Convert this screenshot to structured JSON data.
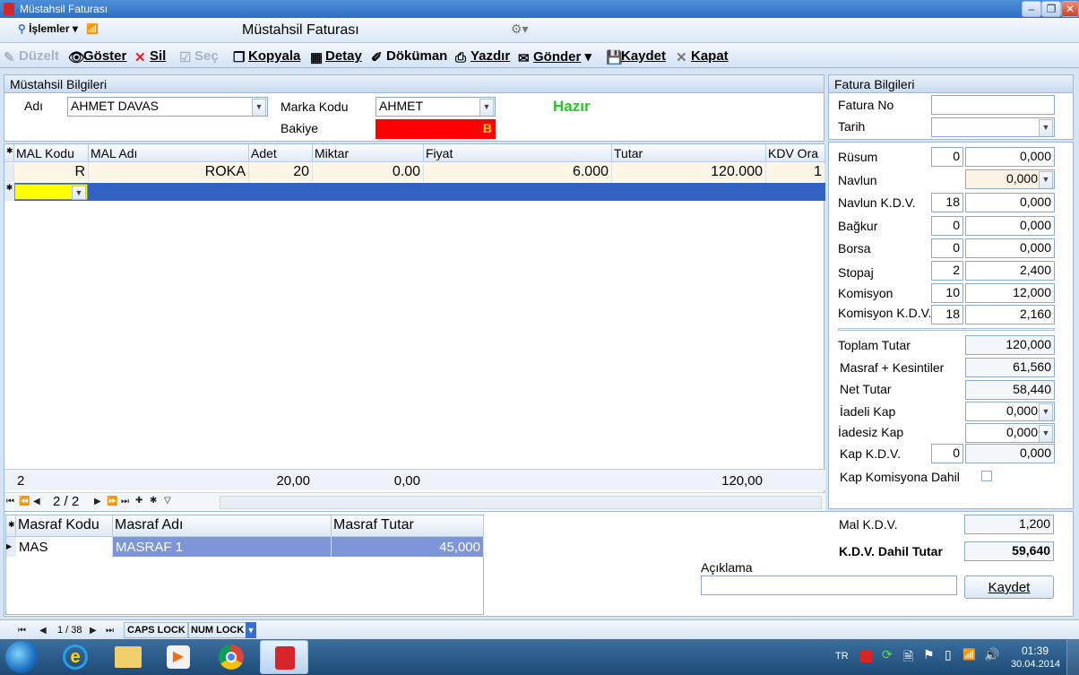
{
  "window": {
    "title": "Müstahsil Faturası"
  },
  "menubar": {
    "menu_label": "İşlemler",
    "form_title": "Müstahsil Faturası"
  },
  "toolbar": {
    "edit": "Düzelt",
    "show": "Göster",
    "delete": "Sil",
    "select": "Seç",
    "copy": "Kopyala",
    "detail": "Detay",
    "document": "Döküman",
    "print": "Yazdır",
    "send": "Gönder",
    "save": "Kaydet",
    "close": "Kapat"
  },
  "producer": {
    "header": "Müstahsil Bilgileri",
    "name_label": "Adı",
    "name_value": "AHMET DAVAS",
    "brand_label": "Marka Kodu",
    "brand_value": "AHMET",
    "balance_label": "Bakiye",
    "balance_value": "B",
    "status": "Hazır"
  },
  "items_grid": {
    "columns": [
      "MAL Kodu",
      "MAL Adı",
      "Adet",
      "Miktar",
      "Fiyat",
      "Tutar",
      "KDV Ora"
    ],
    "rows": [
      {
        "code": "R",
        "name": "ROKA",
        "qty": "20",
        "amount": "0.00",
        "price": "6.000",
        "total": "120.000",
        "vat": "1"
      }
    ],
    "footer": {
      "count": "2",
      "qty": "20,00",
      "amount": "0,00",
      "total": "120,00"
    },
    "nav": {
      "position": "2 / 2"
    }
  },
  "expense_grid": {
    "columns": [
      "Masraf Kodu",
      "Masraf Adı",
      "Masraf Tutar"
    ],
    "rows": [
      {
        "code": "MAS",
        "name": "MASRAF 1",
        "amount": "45,000"
      }
    ]
  },
  "invoice": {
    "header": "Fatura Bilgileri",
    "no_label": "Fatura No",
    "no_value": "",
    "date_label": "Tarih",
    "date_value": ""
  },
  "deductions": [
    {
      "label": "Rüsum",
      "rate": "0",
      "value": "0,000"
    },
    {
      "label": "Navlun",
      "rate": "",
      "value": "0,000"
    },
    {
      "label": "Navlun K.D.V.",
      "rate": "18",
      "value": "0,000"
    },
    {
      "label": "Bağkur",
      "rate": "0",
      "value": "0,000"
    },
    {
      "label": "Borsa",
      "rate": "0",
      "value": "0,000"
    },
    {
      "label": "Stopaj",
      "rate": "2",
      "value": "2,400"
    },
    {
      "label": "Komisyon",
      "rate": "10",
      "value": "12,000"
    },
    {
      "label": "Komisyon K.D.V.",
      "rate": "18",
      "value": "2,160"
    }
  ],
  "totals": {
    "total_label": "Toplam Tutar",
    "total_value": "120,000",
    "expenses_label": "Masraf + Kesintiler",
    "expenses_value": "61,560",
    "net_label": "Net Tutar",
    "net_value": "58,440",
    "returnable_label": "İadeli Kap",
    "returnable_value": "0,000",
    "nonreturnable_label": "İadesiz Kap",
    "nonreturnable_value": "0,000",
    "cont_vat_label": "Kap K.D.V.",
    "cont_vat_rate": "0",
    "cont_vat_value": "0,000",
    "cont_comm_label": "Kap Komisyona Dahil",
    "goods_vat_label": "Mal K.D.V.",
    "goods_vat_value": "1,200",
    "vat_incl_label": "K.D.V. Dahil Tutar",
    "vat_incl_value": "59,640"
  },
  "note": {
    "label": "Açıklama",
    "value": "",
    "save_button": "Kaydet"
  },
  "statusbar": {
    "records": "1 / 38",
    "caps": "CAPS LOCK",
    "num": "NUM LOCK"
  },
  "taskbar": {
    "lang": "TR",
    "time": "01:39",
    "date": "30.04.2014"
  },
  "colors": {
    "accent": "#3a6fc8",
    "balance_bg": "#ff0000",
    "status_green": "#22cc22",
    "selected_row": "#3461c4"
  }
}
